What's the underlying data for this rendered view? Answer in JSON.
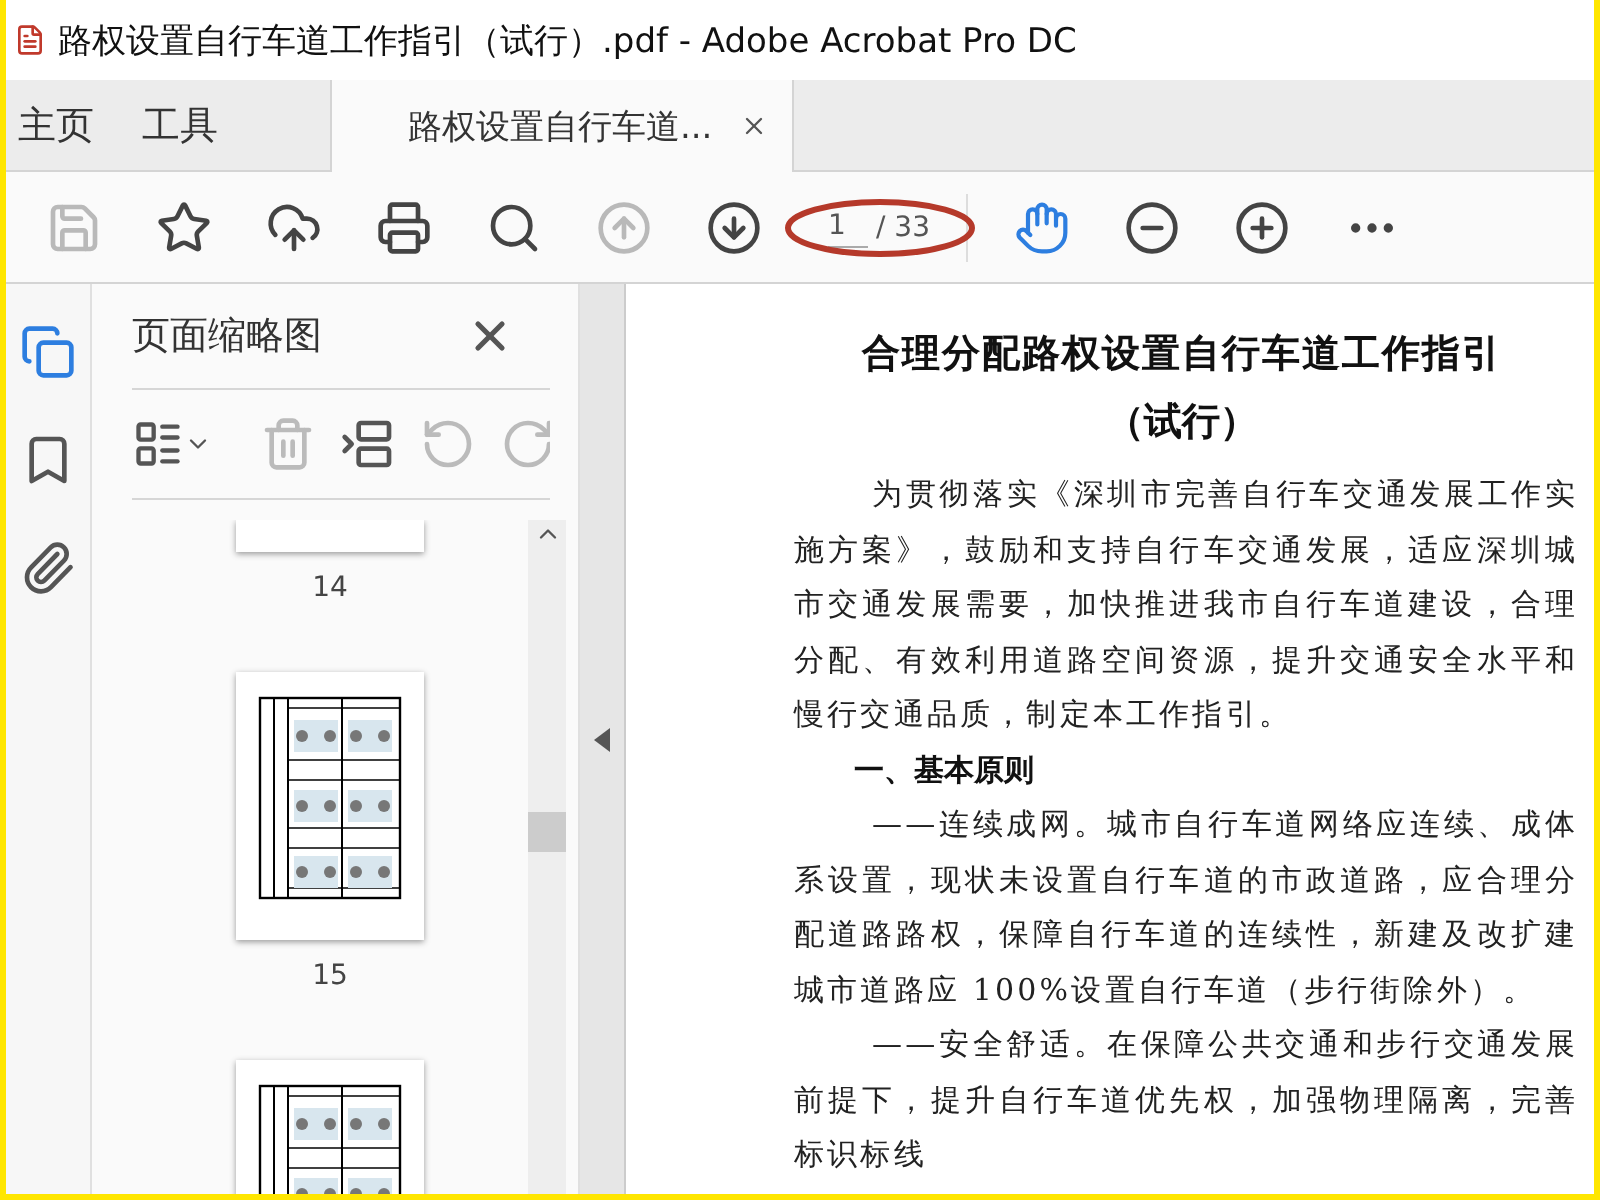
{
  "window": {
    "title": "路权设置自行车道工作指引（试行）.pdf - Adobe Acrobat Pro DC"
  },
  "tabs": [
    {
      "label": "主页",
      "kind": "nav",
      "selected": false
    },
    {
      "label": "工具",
      "kind": "nav",
      "selected": false
    },
    {
      "label": "路权设置自行车道...",
      "kind": "document",
      "selected": true
    }
  ],
  "toolbar": [
    {
      "kind": "save",
      "disabled": true
    },
    {
      "kind": "star",
      "disabled": false
    },
    {
      "kind": "upload",
      "disabled": false
    },
    {
      "kind": "print",
      "disabled": false
    },
    {
      "kind": "find",
      "disabled": false
    },
    {
      "kind": "prev",
      "disabled": true
    },
    {
      "kind": "next",
      "disabled": false
    },
    {
      "kind": "page",
      "value": "1",
      "total": "/ 33"
    },
    {
      "kind": "hand",
      "disabled": false,
      "selected": true
    },
    {
      "kind": "zoom-out",
      "disabled": false
    },
    {
      "kind": "zoom-in",
      "disabled": false
    },
    {
      "kind": "more",
      "disabled": false
    }
  ],
  "rail": [
    {
      "kind": "pages",
      "selected": true
    },
    {
      "kind": "bookmarks",
      "selected": false
    },
    {
      "kind": "attachments",
      "selected": false
    }
  ],
  "panel": {
    "title": "页面缩略图",
    "tools": [
      {
        "kind": "options",
        "disabled": false
      },
      {
        "kind": "delete",
        "disabled": true
      },
      {
        "kind": "insert",
        "disabled": false
      },
      {
        "kind": "undo",
        "disabled": true
      },
      {
        "kind": "rotate",
        "disabled": true
      }
    ],
    "thumbnails": [
      {
        "kind": "cut-top",
        "label": "14"
      },
      {
        "kind": "full",
        "label": "15"
      },
      {
        "kind": "cut-bottom"
      }
    ]
  },
  "document": {
    "title": "合理分配路权设置自行车道工作指引",
    "subtitle": "（试行）",
    "blocks": [
      {
        "kind": "paragraph",
        "text": "为贯彻落实《深圳市完善自行车交通发展工作实施方案》，鼓励和支持自行车交通发展，适应深圳城市交通发展需要，加快推进我市自行车道建设，合理分配、有效利用道路空间资源，提升交通安全水平和慢行交通品质，制定本工作指引。"
      },
      {
        "kind": "heading",
        "text": "一、基本原则"
      },
      {
        "kind": "paragraph",
        "text": "——连续成网。城市自行车道网络应连续、成体系设置，现状未设置自行车道的市政道路，应合理分配道路路权，保障自行车道的连续性，新建及改扩建城市道路应 100%设置自行车道（步行街除外）。"
      },
      {
        "kind": "paragraph",
        "text": "——安全舒适。在保障公共交通和步行交通发展前提下，提升自行车道优先权，加强物理隔离，完善标识标线"
      }
    ]
  }
}
